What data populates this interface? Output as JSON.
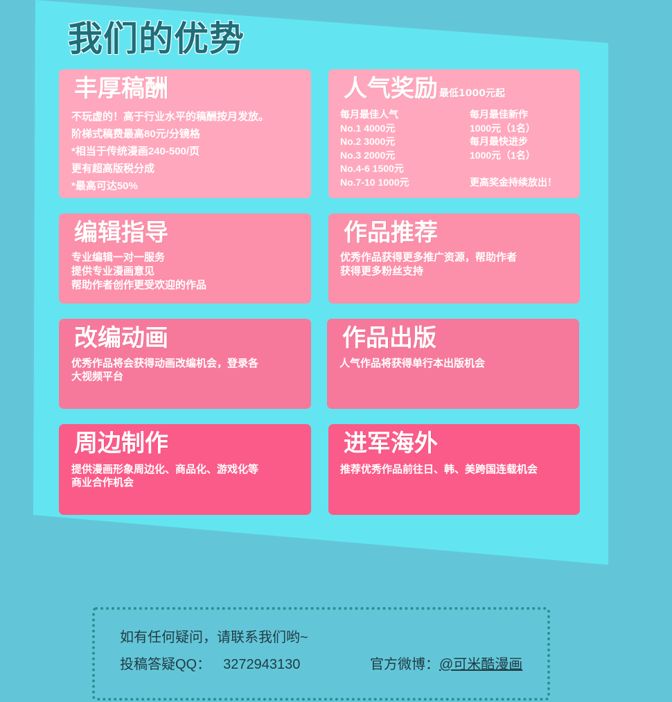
{
  "section_title": "我们的优势",
  "cards": {
    "royalty": {
      "title": "丰厚稿酬",
      "lines": [
        "不玩虚的！高于行业水平的稿酬按月发放。",
        "阶梯式稿费最高80元/分镜格",
        "*相当于传统漫画240-500/页",
        "更有超高版税分成",
        "*最高可达50%"
      ]
    },
    "popularity": {
      "title": "人气奖励",
      "subtitle": "最低1000元起",
      "left_lines": [
        "每月最佳人气",
        "No.1    4000元",
        "No.2     3000元",
        "No.3     2000元",
        "No.4-6    1500元",
        "No.7-10    1000元"
      ],
      "right_lines": [
        "每月最佳新作",
        " 1000元（1名）",
        " 每月最快进步",
        " 1000元（1名）",
        "",
        "更高奖金持续放出！"
      ]
    },
    "editor": {
      "title": "编辑指导",
      "lines": [
        "专业编辑一对一服务",
        "提供专业漫画意见",
        "帮助作者创作更受欢迎的作品"
      ]
    },
    "recommend": {
      "title": "作品推荐",
      "lines": [
        "优秀作品获得更多推广资源，帮助作者",
        "获得更多粉丝支持"
      ]
    },
    "animation": {
      "title": "改编动画",
      "lines": [
        "优秀作品将会获得动画改编机会，登录各",
        "大视频平台"
      ]
    },
    "publish": {
      "title": "作品出版",
      "lines": [
        "人气作品将获得单行本出版机会"
      ]
    },
    "merch": {
      "title": "周边制作",
      "lines": [
        "提供漫画形象周边化、商品化、游戏化等",
        "商业合作机会"
      ]
    },
    "overseas": {
      "title": "进军海外",
      "lines": [
        "推荐优秀作品前往日、韩、美跨国连载机会"
      ]
    }
  },
  "contact": {
    "intro": "如有任何疑问，请联系我们哟~",
    "qq_label": "投稿答疑QQ：",
    "qq_number": "3272943130",
    "weibo_label": "官方微博：",
    "weibo_link": "@可米酷漫画"
  },
  "colors": {
    "background": "#63c6d8",
    "panel": "#62e5f0",
    "card_row1": "#ffa7bd",
    "card_row2": "#fc8fa9",
    "card_row3": "#f6799b",
    "card_row4": "#fb5b88",
    "title_text": "#1f6e79"
  }
}
